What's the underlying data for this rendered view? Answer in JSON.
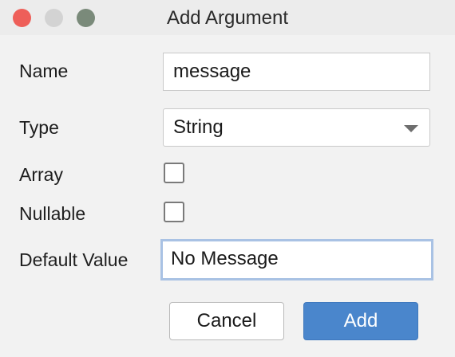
{
  "window": {
    "title": "Add Argument"
  },
  "form": {
    "name_label": "Name",
    "name_value": "message",
    "type_label": "Type",
    "type_value": "String",
    "array_label": "Array",
    "array_checked": false,
    "nullable_label": "Nullable",
    "nullable_checked": false,
    "default_label": "Default Value",
    "default_value": "No Message"
  },
  "buttons": {
    "cancel_label": "Cancel",
    "add_label": "Add"
  },
  "colors": {
    "close": "#ee5f59",
    "primary_button": "#4a86cc",
    "focus_ring": "#a9c2e4"
  },
  "icons": {
    "combo_arrow": "chevron-down-icon"
  }
}
